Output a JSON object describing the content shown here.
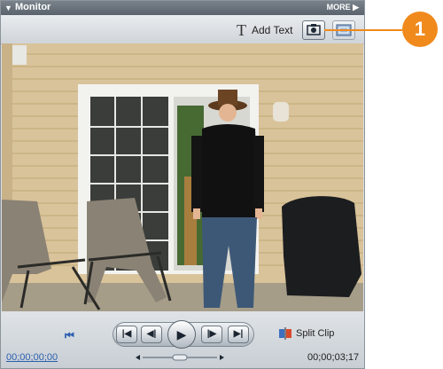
{
  "panel": {
    "title": "Monitor",
    "more_label": "MORE"
  },
  "toolbar": {
    "add_text_label": "Add Text"
  },
  "controls": {
    "split_clip_label": "Split Clip",
    "timecode_current": "00;00;00;00",
    "timecode_duration": "00;00;03;17"
  },
  "callout": {
    "number": "1"
  },
  "icons": {
    "title_triangle": "triangle-down",
    "more_arrow": "triangle-right",
    "add_text": "text-T",
    "camera": "camera-icon",
    "safe_margin": "safe-margin-icon"
  },
  "colors": {
    "callout": "#f08a1c",
    "link_blue": "#2c5fae"
  }
}
